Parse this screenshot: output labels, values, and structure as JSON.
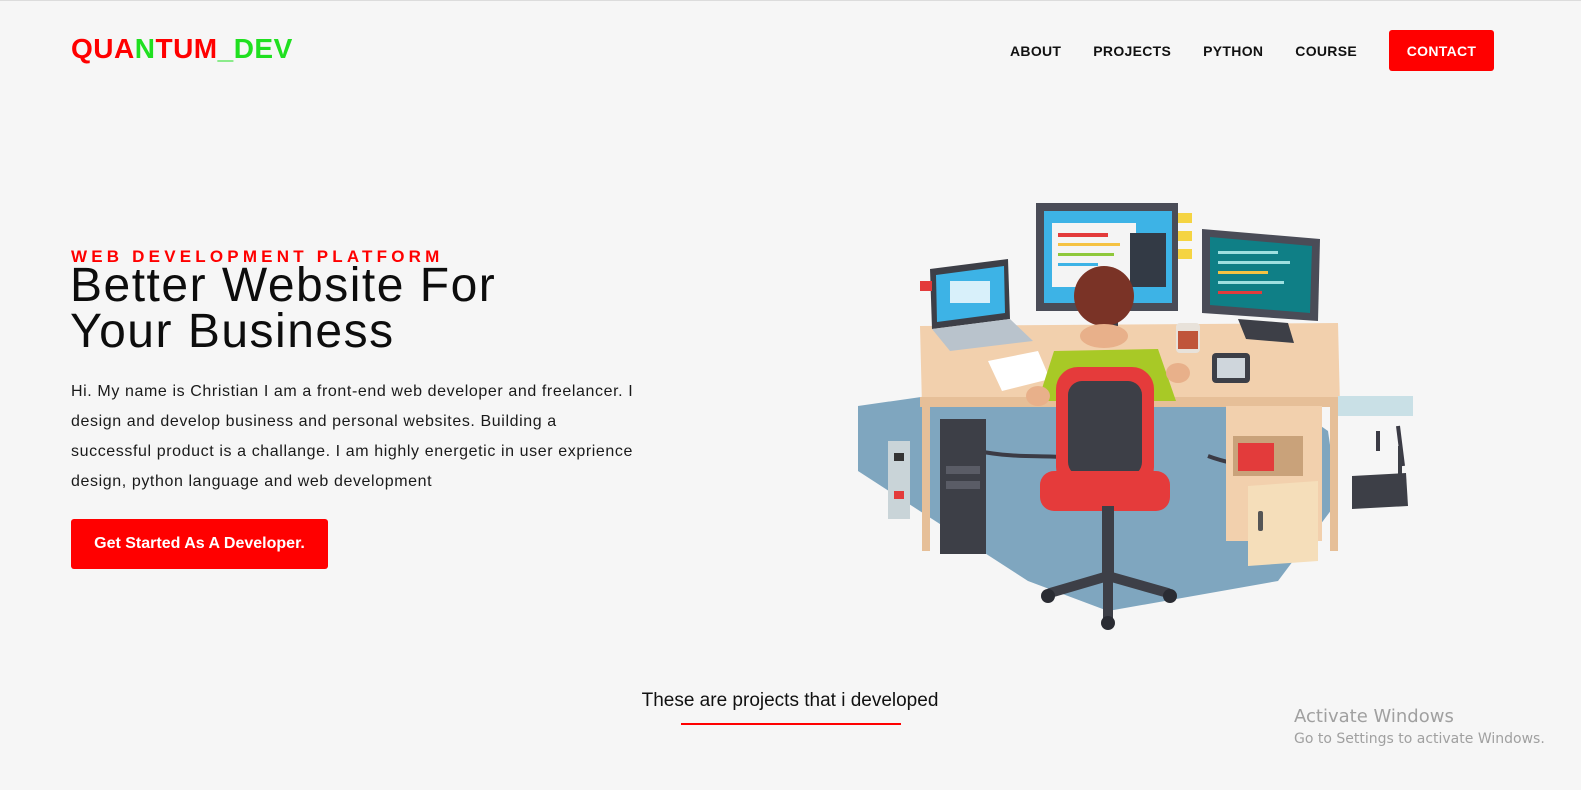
{
  "brand": {
    "parts": [
      {
        "text": "QUA",
        "color": "#ff0000"
      },
      {
        "text": "N",
        "color": "#20e020"
      },
      {
        "text": "TUM",
        "color": "#ff0000"
      },
      {
        "text": "_DEV",
        "color": "#20e020"
      }
    ]
  },
  "nav": {
    "items": [
      "ABOUT",
      "PROJECTS",
      "PYTHON",
      "COURSE"
    ],
    "contact_label": "CONTACT"
  },
  "hero": {
    "eyebrow": "WEB DEVELOPMENT PLATFORM",
    "title_line1": "Better Website For",
    "title_line2": "Your Business",
    "intro": "Hi. My name is Christian I am a front-end web developer and freelancer. I design and develop business and personal websites. Building a successful product is a challange. I am highly energetic in user exprience design, python language and web development",
    "cta_label": "Get Started As A Developer."
  },
  "projects": {
    "heading": "These are projects that i developed"
  },
  "windows_notice": {
    "line1": "Activate Windows",
    "line2": "Go to Settings to activate Windows."
  },
  "colors": {
    "accent": "#ff0000",
    "brand_green": "#20e020",
    "background": "#f6f6f6"
  },
  "illustration": {
    "icon": "developer-at-desk-illustration"
  }
}
